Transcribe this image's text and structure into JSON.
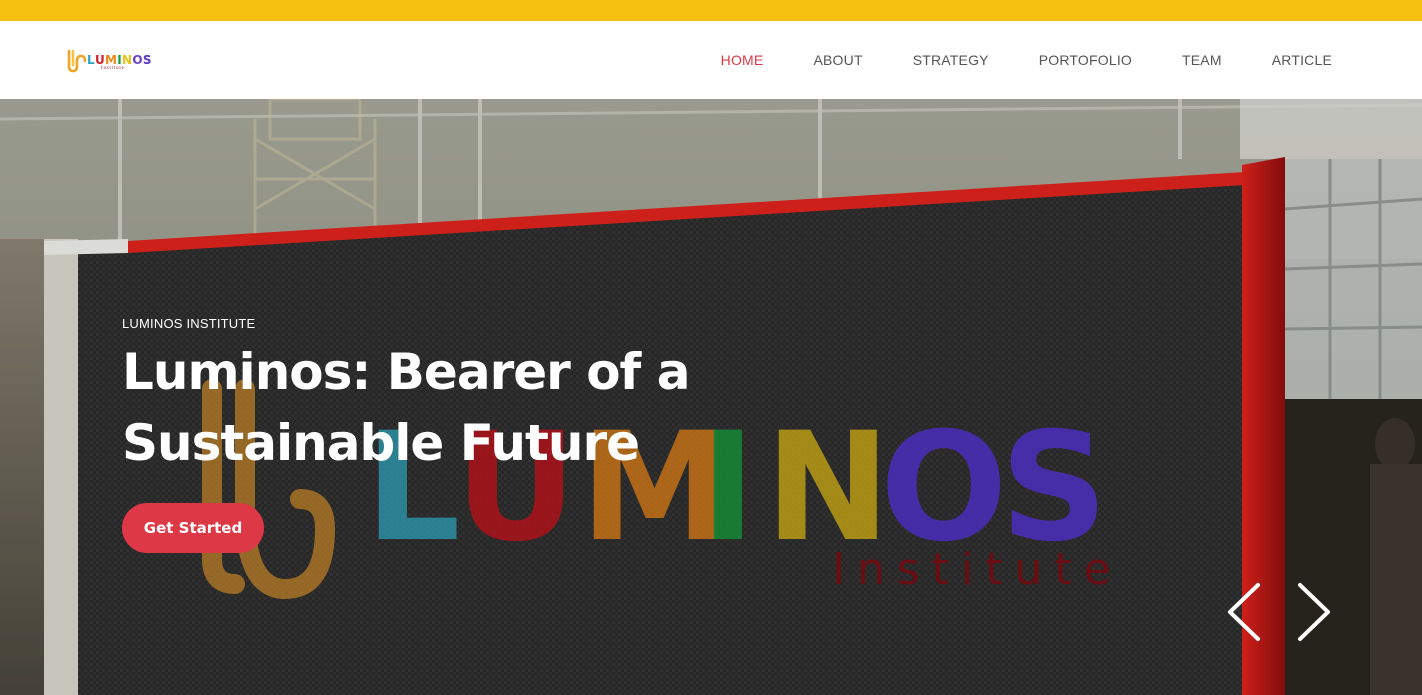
{
  "logo": {
    "letters": [
      {
        "char": "L",
        "color": "#2aa7c4"
      },
      {
        "char": "U",
        "color": "#d0202a"
      },
      {
        "char": "M",
        "color": "#ec8a17"
      },
      {
        "char": "I",
        "color": "#1a9b3a"
      },
      {
        "char": "N",
        "color": "#e8c314"
      },
      {
        "char": "O",
        "color": "#6a3fd0"
      },
      {
        "char": "S",
        "color": "#5b34c8"
      }
    ],
    "subtitle": "Institute",
    "icon": "luminos-logo-mark-icon"
  },
  "nav": {
    "items": [
      {
        "label": "HOME",
        "active": true
      },
      {
        "label": "ABOUT",
        "active": false
      },
      {
        "label": "STRATEGY",
        "active": false
      },
      {
        "label": "PORTOFOLIO",
        "active": false
      },
      {
        "label": "TEAM",
        "active": false
      },
      {
        "label": "ARTICLE",
        "active": false
      }
    ]
  },
  "hero": {
    "eyebrow": "LUMINOS INSTITUTE",
    "headline": "Luminos: Bearer of a Sustainable Future",
    "cta_label": "Get Started",
    "sign_lettering": "LUMINOS",
    "sign_sublettering": "Institute",
    "prev_icon": "chevron-left-icon",
    "next_icon": "chevron-right-icon"
  },
  "colors": {
    "top_strip": "#f5c00f",
    "accent": "#dd3846",
    "nav_text": "#555555"
  }
}
